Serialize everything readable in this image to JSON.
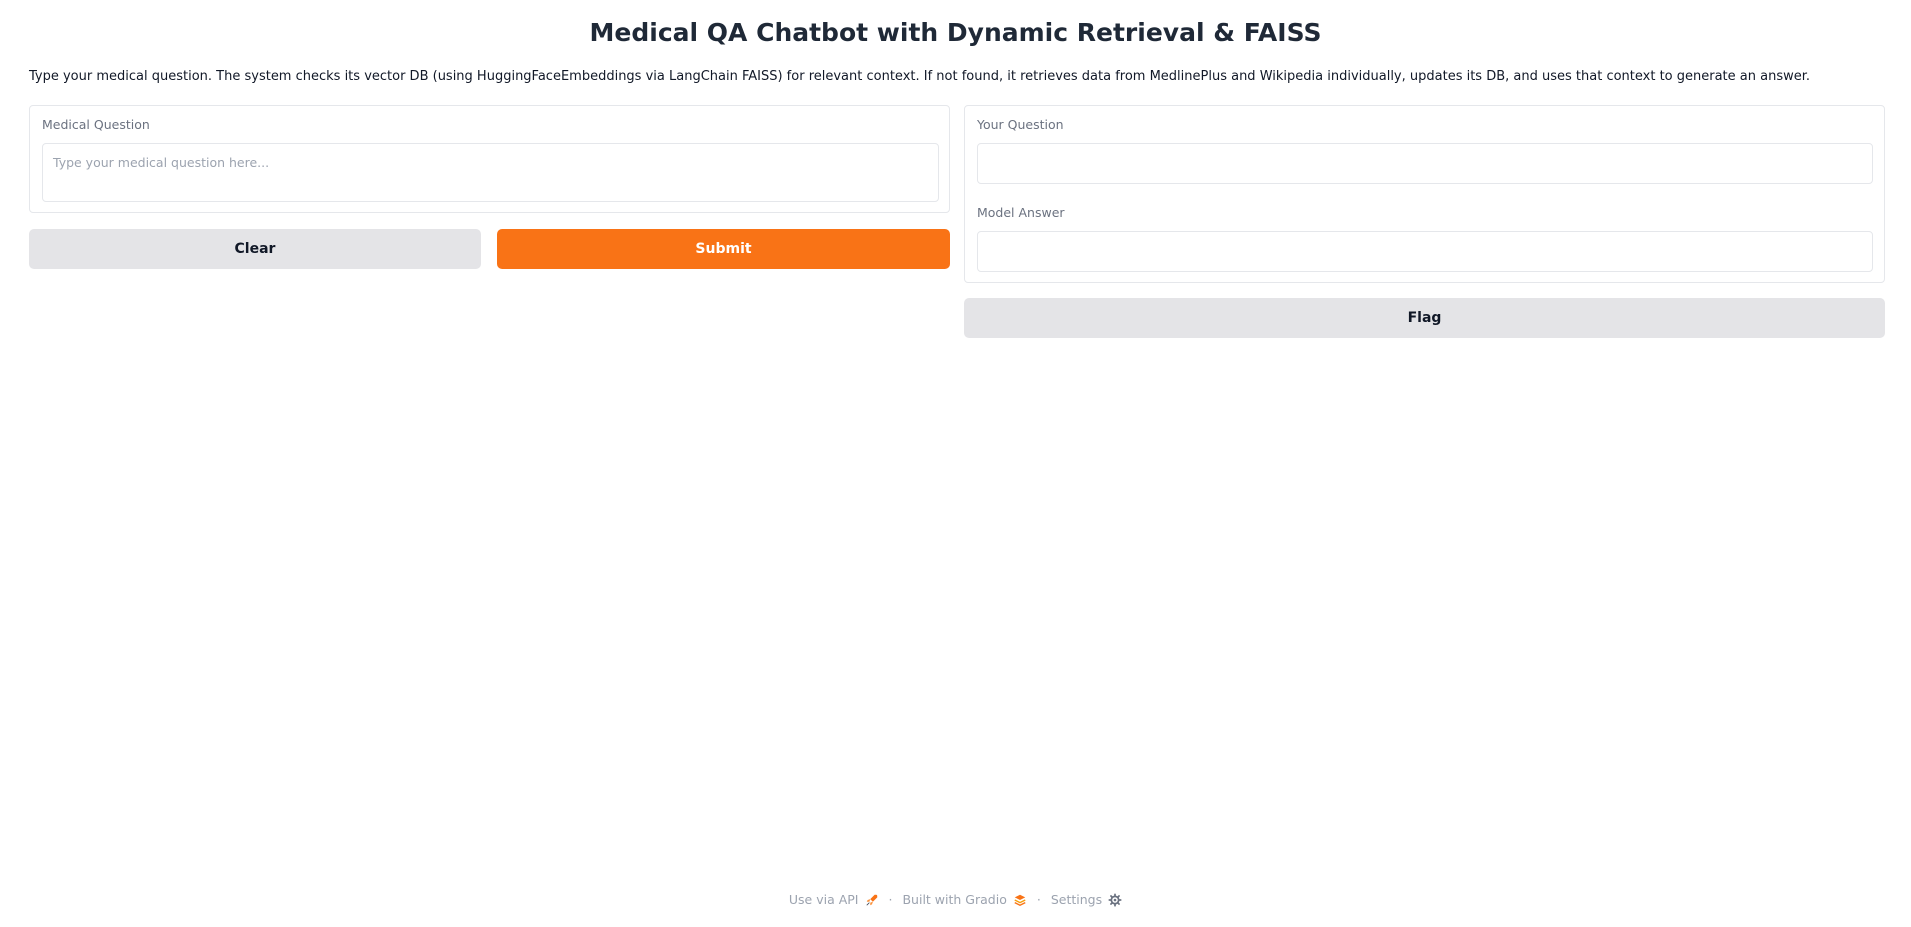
{
  "header": {
    "title": "Medical QA Chatbot with Dynamic Retrieval & FAISS",
    "description": "Type your medical question. The system checks its vector DB (using HuggingFaceEmbeddings via LangChain FAISS) for relevant context. If not found, it retrieves data from MedlinePlus and Wikipedia individually, updates its DB, and uses that context to generate an answer."
  },
  "input_panel": {
    "label": "Medical Question",
    "placeholder": "Type your medical question here...",
    "value": ""
  },
  "buttons": {
    "clear_label": "Clear",
    "submit_label": "Submit",
    "flag_label": "Flag"
  },
  "output_panel": {
    "question_label": "Your Question",
    "question_value": "",
    "answer_label": "Model Answer",
    "answer_value": ""
  },
  "footer": {
    "api_label": "Use via API",
    "api_icon": "rocket-icon",
    "built_label": "Built with Gradio",
    "built_icon": "gradio-logo-icon",
    "settings_label": "Settings",
    "settings_icon": "gear-icon",
    "separator": "·"
  },
  "colors": {
    "accent": "#f97316",
    "secondary_button": "#e4e4e7",
    "border": "#e5e7eb"
  }
}
